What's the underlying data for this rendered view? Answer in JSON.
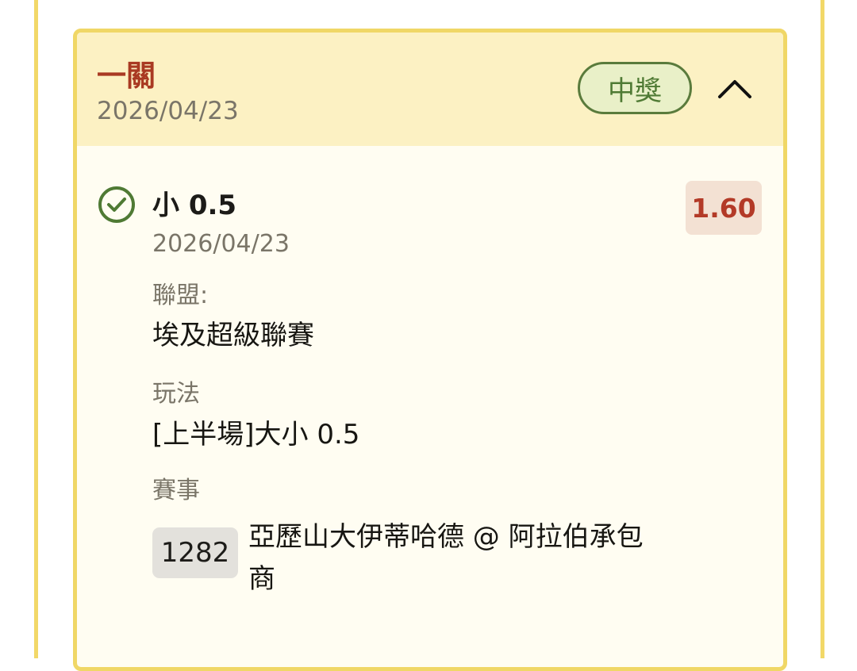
{
  "card": {
    "bet_type": "一關",
    "date": "2026/04/23",
    "status": "中獎",
    "toggle_icon": "chevron-up-icon",
    "colors": {
      "card_bg": "#fffdf2",
      "header_bg": "#fcf1c3",
      "border": "#f0d766",
      "accent_red": "#b33a27",
      "success_green": "#4f7a34"
    }
  },
  "selection": {
    "result_icon": "check-circle-icon",
    "name": "小 0.5",
    "date": "2026/04/23",
    "odds": "1.60",
    "fields": {
      "league_label": "聯盟:",
      "league_value": "埃及超級聯賽",
      "market_label": "玩法",
      "market_value": "[上半場]大小 0.5",
      "event_label": "賽事",
      "event_id": "1282",
      "event_name": "亞歷山大伊蒂哈德 @ 阿拉伯承包商"
    }
  }
}
